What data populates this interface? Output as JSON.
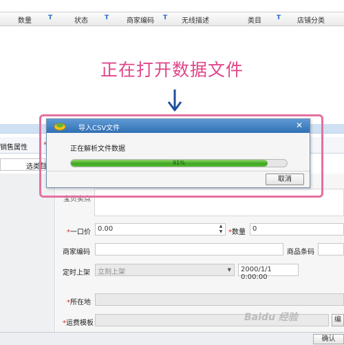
{
  "grid_header": {
    "columns": [
      "数量",
      "状态",
      "商家编码",
      "无线描述",
      "类目",
      "店铺分类"
    ],
    "filter_glyph": "T"
  },
  "annotation": {
    "title": "正在打开数据文件",
    "arrow": "arrow-down-icon"
  },
  "background_form": {
    "tab_label": "销售属性",
    "select_button": "选类目",
    "label_title_partial": "宝贝卖点",
    "price_label": "一口价",
    "price_value": "0.00",
    "quantity_label": "数量",
    "quantity_value": "0",
    "merchant_code_label": "商家编码",
    "barcode_label": "商品条码",
    "schedule_label": "定时上架",
    "schedule_value": "立刻上架",
    "schedule_date": "2000/1/1 0:00:00",
    "location_label": "所在地",
    "shipping_label": "运费模板",
    "edit_button": "编辑",
    "bottom_button": "确认"
  },
  "dialog": {
    "title": "导入CSV文件",
    "icon": "app-logo-icon",
    "message": "正在解析文件数据",
    "progress_percent": 91,
    "progress_text": "91%",
    "cancel_label": "取消",
    "close_icon": "close-icon"
  },
  "watermark": "Baidu 经验",
  "colors": {
    "annotation": "#e0458a",
    "frame": "#e4709f",
    "titlebar": "#2f6fb4",
    "progress": "#3fa722",
    "required": "#d9261c"
  }
}
